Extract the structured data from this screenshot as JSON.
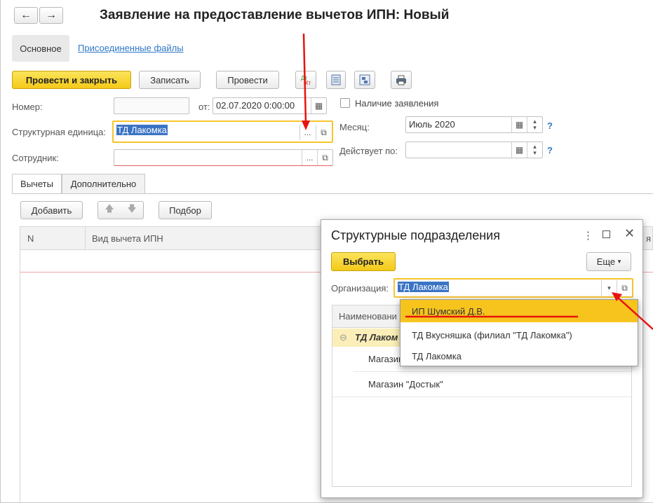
{
  "window": {
    "title": "Заявление на предоставление вычетов ИПН: Новый",
    "nav_back": "←",
    "nav_forward": "→"
  },
  "section_tabs": {
    "main": "Основное",
    "attached": "Присоединенные файлы"
  },
  "toolbar": {
    "post_close": "Провести и закрыть",
    "save": "Записать",
    "post": "Провести"
  },
  "form": {
    "number_label": "Номер:",
    "number_value": "",
    "date_label": "от:",
    "date_value": "02.07.2020  0:00:00",
    "statement_checkbox_label": "Наличие заявления",
    "unit_label": "Структурная единица:",
    "unit_value": "ТД Лакомка",
    "month_label": "Месяц:",
    "month_value": "Июль 2020",
    "employee_label": "Сотрудник:",
    "employee_value": "",
    "valid_until_label": "Действует по:",
    "valid_until_value": "",
    "help_mark": "?"
  },
  "tabs": {
    "deductions": "Вычеты",
    "additional": "Дополнительно"
  },
  "grid_toolbar": {
    "add": "Добавить",
    "pick": "Подбор"
  },
  "grid": {
    "col_n": "N",
    "col_type": "Вид вычета ИПН",
    "col_cut": "я"
  },
  "popup": {
    "title": "Структурные подразделения",
    "choose": "Выбрать",
    "more": "Еще",
    "org_label": "Организация:",
    "org_value": "ТД Лакомка",
    "col_name": "Наименовани",
    "tree_root": "ТД Лаком",
    "rows": [
      "Магазин",
      "Магазин \"Достык\""
    ]
  },
  "dropdown": {
    "items": [
      "ИП Шумский Д.В.",
      "ТД Вкусняшка (филиал \"ТД Лакомка\")",
      "ТД Лакомка"
    ],
    "selected_index": 0
  },
  "colors": {
    "accent_yellow": "#f4c918",
    "link_blue": "#2e78c7",
    "annotation_red": "#e8130c",
    "selection_blue": "#3b74c4"
  }
}
